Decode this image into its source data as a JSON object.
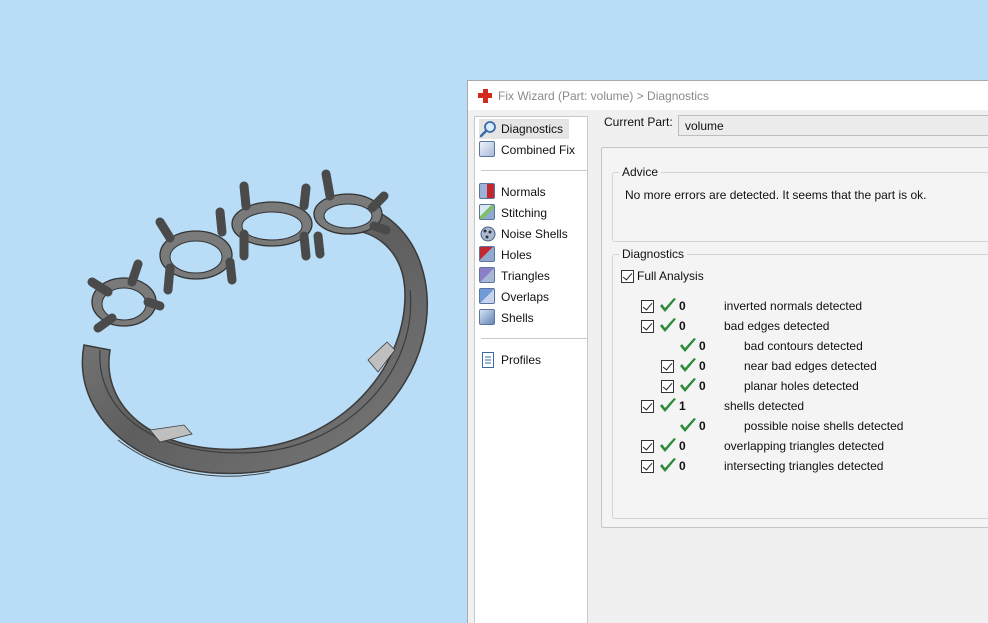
{
  "window": {
    "title": "Fix Wizard (Part: volume) > Diagnostics"
  },
  "sidebar": {
    "items": [
      {
        "label": "Diagnostics",
        "icon": "magnifier-icon",
        "selected": true
      },
      {
        "label": "Combined Fix",
        "icon": "combined-fix-cube-icon"
      },
      {
        "label": "Normals",
        "icon": "normals-cube-icon"
      },
      {
        "label": "Stitching",
        "icon": "stitching-cube-icon"
      },
      {
        "label": "Noise Shells",
        "icon": "noise-shells-icon"
      },
      {
        "label": "Holes",
        "icon": "holes-cube-icon"
      },
      {
        "label": "Triangles",
        "icon": "triangles-cube-icon"
      },
      {
        "label": "Overlaps",
        "icon": "overlaps-cube-icon"
      },
      {
        "label": "Shells",
        "icon": "shells-cube-icon"
      },
      {
        "label": "Profiles",
        "icon": "document-icon"
      }
    ]
  },
  "current_part": {
    "label": "Current Part:",
    "value": "volume"
  },
  "advice": {
    "legend": "Advice",
    "text": "No more errors are detected. It seems that the part is ok."
  },
  "diagnostics": {
    "legend": "Diagnostics",
    "full_analysis_label": "Full Analysis",
    "rows": [
      {
        "count": "0",
        "label": "inverted normals detected",
        "checkbox": true,
        "indent": 0
      },
      {
        "count": "0",
        "label": "bad edges detected",
        "checkbox": true,
        "indent": 0
      },
      {
        "count": "0",
        "label": "bad contours detected",
        "checkbox": false,
        "indent": 1
      },
      {
        "count": "0",
        "label": "near bad edges detected",
        "checkbox": true,
        "indent": 1
      },
      {
        "count": "0",
        "label": "planar holes detected",
        "checkbox": true,
        "indent": 1
      },
      {
        "count": "1",
        "label": "shells detected",
        "checkbox": true,
        "indent": 0
      },
      {
        "count": "0",
        "label": "possible noise shells detected",
        "checkbox": false,
        "indent": 1
      },
      {
        "count": "0",
        "label": "overlapping triangles detected",
        "checkbox": true,
        "indent": 0
      },
      {
        "count": "0",
        "label": "intersecting triangles detected",
        "checkbox": true,
        "indent": 0
      }
    ]
  },
  "colors": {
    "viewport_background": "#b9ddf7",
    "model": "#6f6f6f",
    "check_green": "#2e8b3a",
    "app_icon_red": "#d42a1e"
  }
}
